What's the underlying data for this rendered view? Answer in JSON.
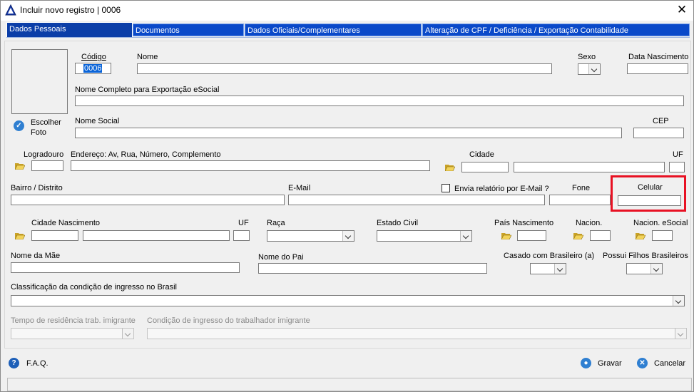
{
  "window": {
    "title": "Incluir novo registro | 0006",
    "close_symbol": "✕"
  },
  "tabs": [
    {
      "label": "Dados Pessoais"
    },
    {
      "label": "Documentos"
    },
    {
      "label": "Dados Oficiais/Complementares"
    },
    {
      "label": "Alteração de CPF / Deficiência / Exportação Contabilidade"
    }
  ],
  "photo": {
    "choose_label_1": "Escolher",
    "choose_label_2": "Foto"
  },
  "form": {
    "codigo_label": "Código",
    "codigo_value": "0006",
    "nome_label": "Nome",
    "sexo_label": "Sexo",
    "data_nascimento_label": "Data Nascimento",
    "nome_completo_label": "Nome Completo para Exportação eSocial",
    "nome_social_label": "Nome Social",
    "cep_label": "CEP",
    "logradouro_label": "Logradouro",
    "endereco_label": "Endereço: Av, Rua, Número, Complemento",
    "cidade_label": "Cidade",
    "uf_label": "UF",
    "bairro_label": "Bairro / Distrito",
    "email_label": "E-Mail",
    "envia_relatorio_label": "Envia relatório por E-Mail ?",
    "fone_label": "Fone",
    "celular_label": "Celular",
    "cidade_nascimento_label": "Cidade Nascimento",
    "uf2_label": "UF",
    "raca_label": "Raça",
    "estado_civil_label": "Estado Civil",
    "pais_nascimento_label": "País Nascimento",
    "nacion_label": "Nacion.",
    "nacion_esocial_label": "Nacion. eSocial",
    "nome_mae_label": "Nome da Mãe",
    "nome_pai_label": "Nome do Pai",
    "casado_brasileiro_label": "Casado com Brasileiro (a)",
    "possui_filhos_label": "Possui Filhos Brasileiros",
    "classificacao_label": "Classificação da condição de ingresso no Brasil",
    "tempo_residencia_label": "Tempo de residência trab. imigrante",
    "condicao_ingresso_label": "Condição de ingresso do trabalhador imigrante"
  },
  "footer": {
    "faq_label": "F.A.Q.",
    "gravar_label": "Gravar",
    "cancelar_label": "Cancelar"
  },
  "colors": {
    "tab_blue": "#0a49c9",
    "highlight_red": "#e81123",
    "selection_blue": "#0a64d8"
  }
}
